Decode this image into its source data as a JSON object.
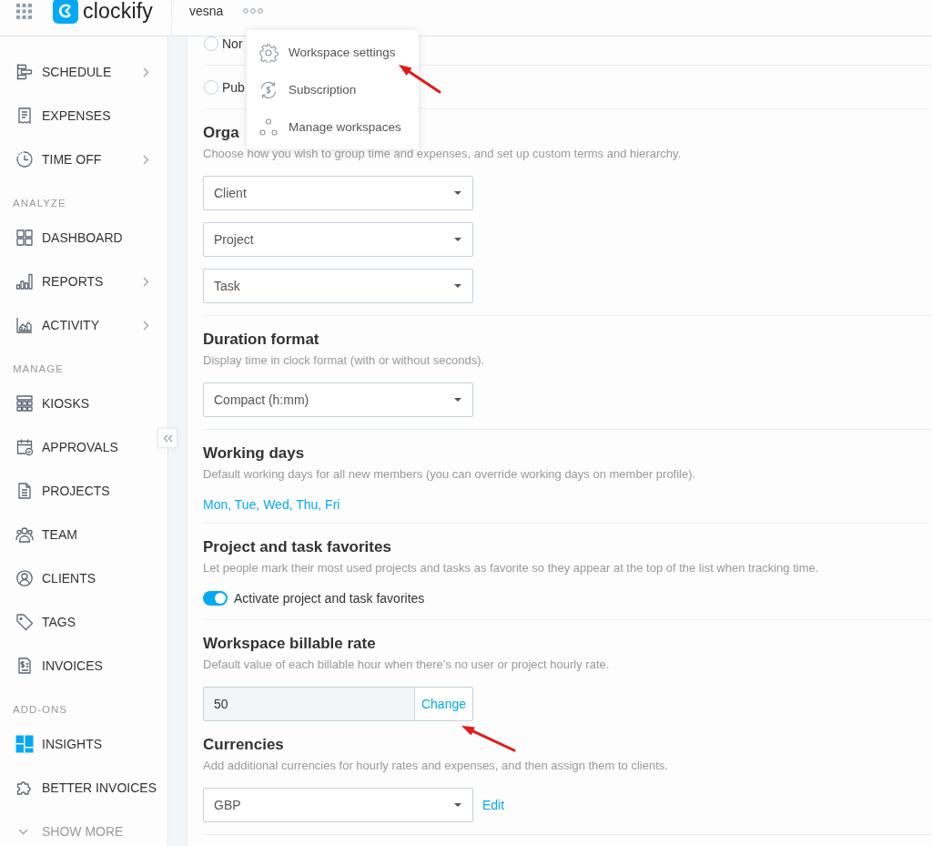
{
  "header": {
    "app_name": "clockify",
    "workspace": "vesna"
  },
  "workspace_menu": {
    "items": [
      "Workspace settings",
      "Subscription",
      "Manage workspaces"
    ]
  },
  "sidebar": {
    "sections": [
      {
        "items": [
          {
            "label": "SCHEDULE",
            "has_submenu": true
          },
          {
            "label": "EXPENSES",
            "has_submenu": false
          },
          {
            "label": "TIME OFF",
            "has_submenu": true
          }
        ]
      },
      {
        "title": "ANALYZE",
        "items": [
          {
            "label": "DASHBOARD",
            "has_submenu": false
          },
          {
            "label": "REPORTS",
            "has_submenu": true
          },
          {
            "label": "ACTIVITY",
            "has_submenu": true
          }
        ]
      },
      {
        "title": "MANAGE",
        "items": [
          {
            "label": "KIOSKS",
            "has_submenu": false
          },
          {
            "label": "APPROVALS",
            "has_submenu": false
          },
          {
            "label": "PROJECTS",
            "has_submenu": false
          },
          {
            "label": "TEAM",
            "has_submenu": false
          },
          {
            "label": "CLIENTS",
            "has_submenu": false
          },
          {
            "label": "TAGS",
            "has_submenu": false
          },
          {
            "label": "INVOICES",
            "has_submenu": false
          }
        ]
      },
      {
        "title": "ADD-ONS",
        "items": [
          {
            "label": "INSIGHTS",
            "has_submenu": false
          },
          {
            "label": "BETTER INVOICES",
            "has_submenu": false
          }
        ]
      }
    ],
    "show_more": "SHOW MORE"
  },
  "privacy_options": [
    {
      "label": "Nor",
      "selected": false
    },
    {
      "label": "Pub",
      "selected": false
    }
  ],
  "sections": [
    {
      "kind": "selects",
      "title": "Orga",
      "description": "Choose how you wish to group time and expenses, and set up custom terms and hierarchy.",
      "selects": [
        "Client",
        "Project",
        "Task"
      ]
    },
    {
      "kind": "selects",
      "title": "Duration format",
      "description": "Display time in clock format (with or without seconds).",
      "selects": [
        "Compact (h:mm)"
      ]
    },
    {
      "kind": "link",
      "title": "Working days",
      "description": "Default working days for all new members (you can override working days on member profile).",
      "link": "Mon, Tue, Wed, Thu, Fri"
    },
    {
      "kind": "toggle",
      "title": "Project and task favorites",
      "description": "Let people mark their most used projects and tasks as favorite so they appear at the top of the list when tracking time.",
      "toggle": {
        "label": "Activate project and task favorites",
        "on": true
      }
    },
    {
      "kind": "rate",
      "title": "Workspace billable rate",
      "description": "Default value of each billable hour when there’s no user or project hourly rate.",
      "value": "50",
      "button": "Change"
    },
    {
      "kind": "currency",
      "title": "Currencies",
      "description": "Add additional currencies for hourly rates and expenses, and then assign them to clients.",
      "select": "GBP",
      "link": "Edit"
    }
  ]
}
